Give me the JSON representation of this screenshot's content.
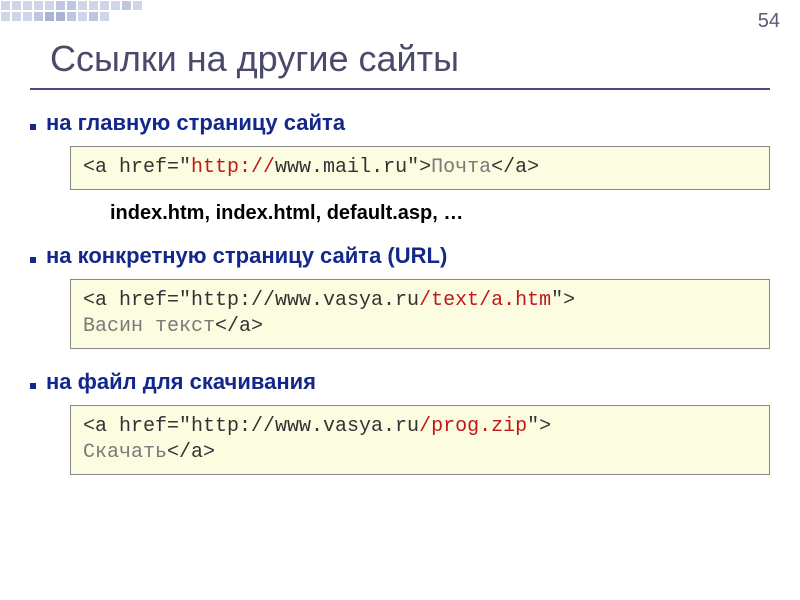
{
  "page_number": "54",
  "title": "Ссылки на другие сайты",
  "sections": [
    {
      "bullet": "на главную страницу сайта",
      "code": {
        "p1": "<a href=\"",
        "scheme": "http://",
        "p2": "www.mail.ru\">",
        "linktext": "Почта",
        "p3": "</a>"
      },
      "note": "index.htm, index.html, default.asp, …"
    },
    {
      "bullet": "на конкретную страницу сайта (URL)",
      "code": {
        "p1": "<a href=\"http://www.vasya.ru",
        "path": "/text/a.htm",
        "p2": "\">",
        "linktext": "Васин текст",
        "p3": "</a>"
      }
    },
    {
      "bullet": "на файл для скачивания",
      "code": {
        "p1": "<a href=\"http://www.vasya.ru",
        "path": "/prog.zip",
        "p2": "\">",
        "linktext": "Скачать",
        "p3": "</a>"
      }
    }
  ]
}
